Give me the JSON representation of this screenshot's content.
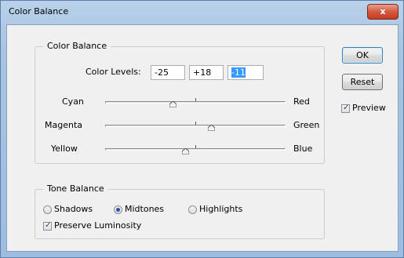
{
  "window": {
    "title": "Color Balance",
    "close_glyph": "x"
  },
  "color_balance": {
    "group_label": "Color Balance",
    "levels_label": "Color Levels:",
    "levels": [
      "-25",
      "+18",
      "-11"
    ],
    "rows": [
      {
        "left": "Cyan",
        "right": "Red",
        "value": -25
      },
      {
        "left": "Magenta",
        "right": "Green",
        "value": 18
      },
      {
        "left": "Yellow",
        "right": "Blue",
        "value": -11
      }
    ]
  },
  "tone_balance": {
    "group_label": "Tone Balance",
    "options": [
      "Shadows",
      "Midtones",
      "Highlights"
    ],
    "selected": "Midtones",
    "preserve_label": "Preserve Luminosity",
    "preserve_checked": true
  },
  "buttons": {
    "ok": "OK",
    "reset": "Reset"
  },
  "preview": {
    "label": "Preview",
    "checked": true
  }
}
